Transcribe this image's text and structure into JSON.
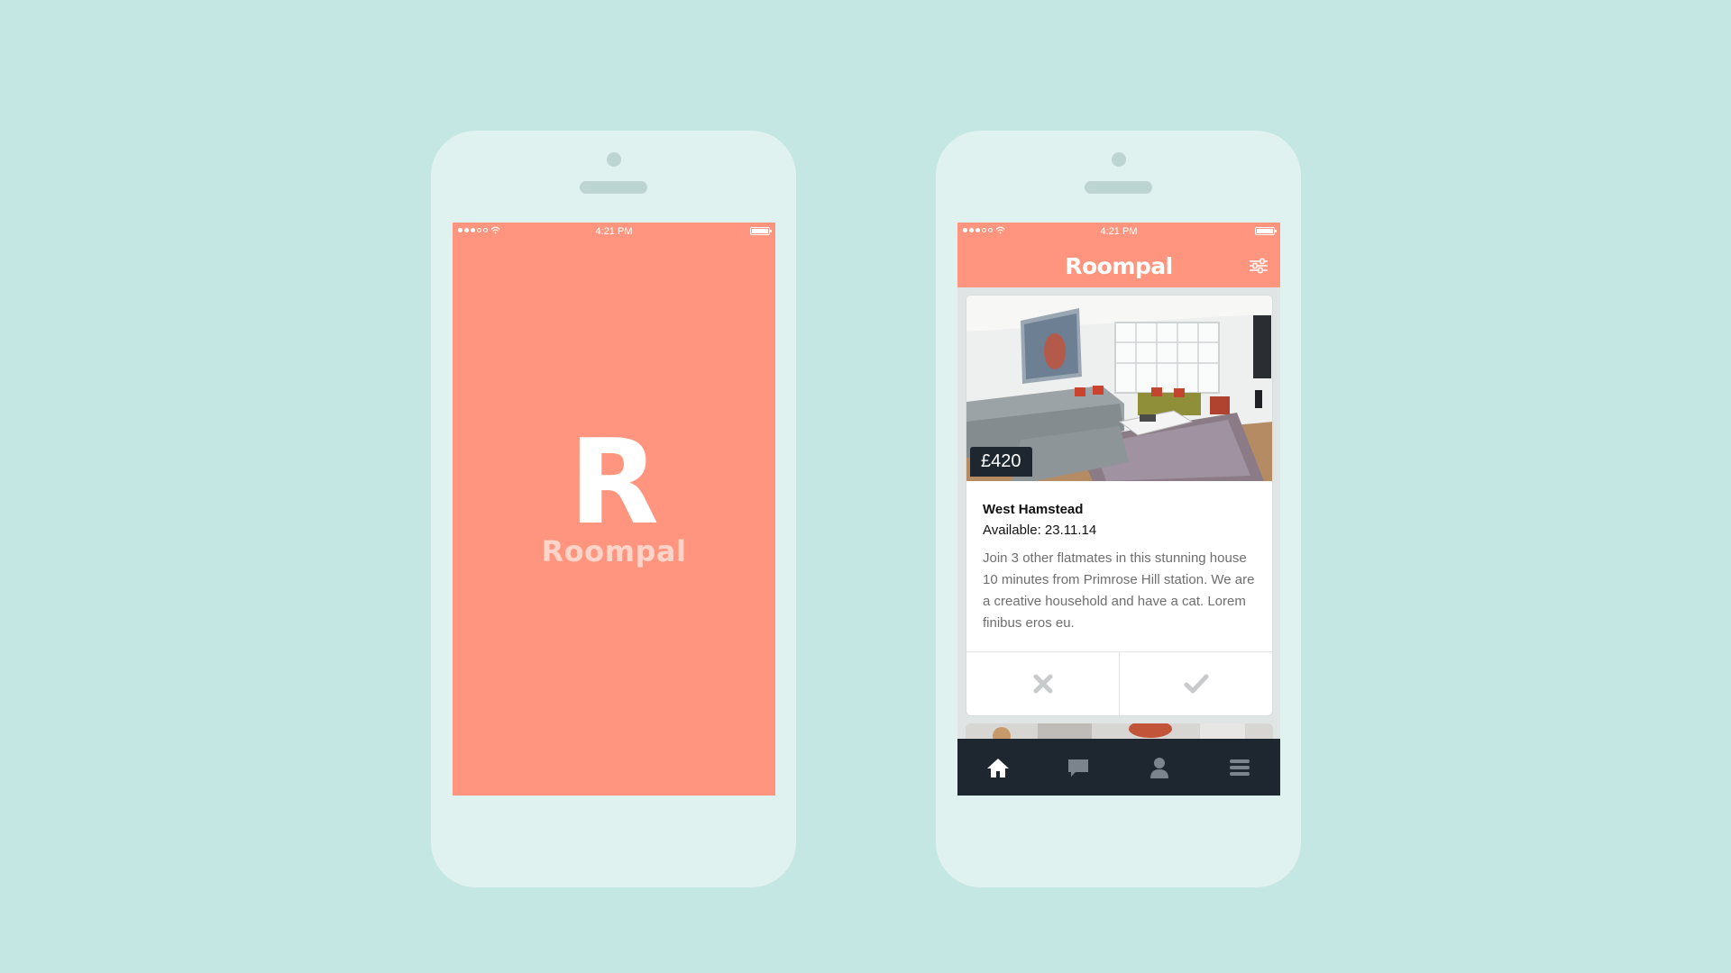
{
  "status_bar": {
    "time": "4:21 PM"
  },
  "splash": {
    "logo_letter": "R",
    "app_name": "Roompal"
  },
  "feed": {
    "nav_title": "Roompal",
    "listing": {
      "price": "£420",
      "title": "West Hamstead",
      "available": "Available: 23.11.14",
      "description": "Join 3 other flatmates in this stunning house 10 minutes from Primrose Hill station. We are a creative household and have a cat. Lorem finibus eros eu."
    },
    "tabs": [
      {
        "icon": "home-icon",
        "active": true
      },
      {
        "icon": "chat-icon",
        "active": false
      },
      {
        "icon": "profile-icon",
        "active": false
      },
      {
        "icon": "menu-icon",
        "active": false
      }
    ]
  },
  "colors": {
    "background": "#c5e7e3",
    "phone": "#e0f2ef",
    "brand_coral": "#ff957e",
    "dark_navy": "#1e2730"
  }
}
